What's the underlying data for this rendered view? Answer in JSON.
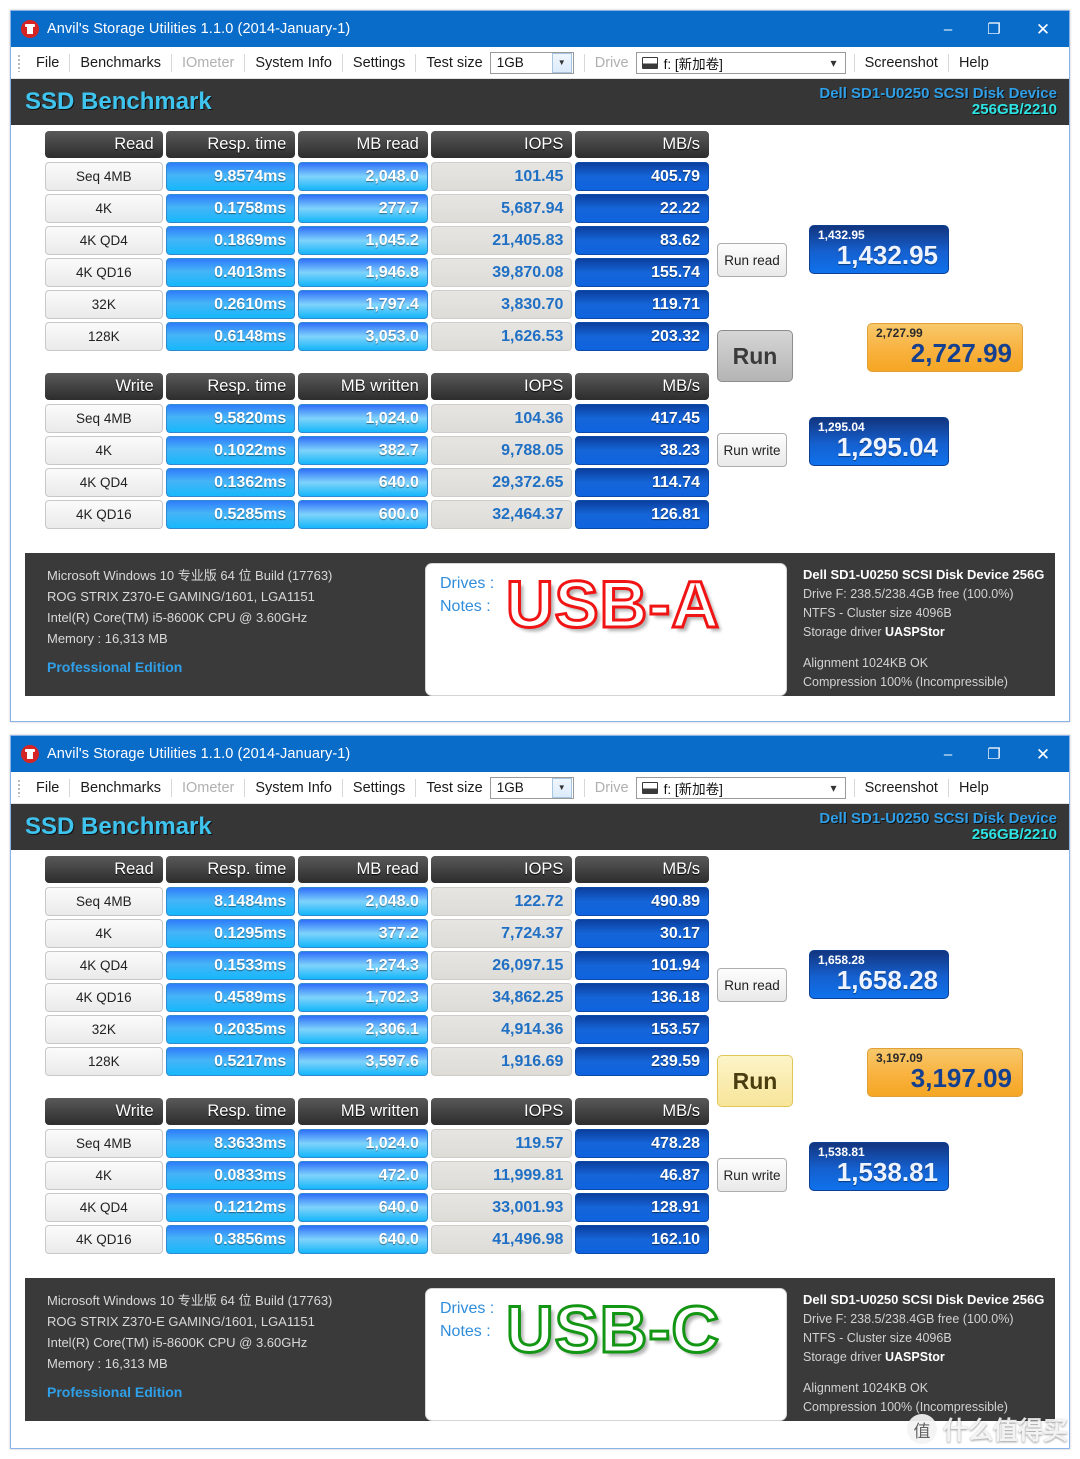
{
  "window": {
    "title": "Anvil's Storage Utilities 1.1.0 (2014-January-1)",
    "icon": "anvil-icon",
    "minimize": "–",
    "maximize": "❐",
    "close": "✕"
  },
  "menu": {
    "items": [
      {
        "label": "File",
        "disabled": false
      },
      {
        "label": "Benchmarks",
        "disabled": false
      },
      {
        "label": "IOmeter",
        "disabled": true
      },
      {
        "label": "System Info",
        "disabled": false
      },
      {
        "label": "Settings",
        "disabled": false
      }
    ],
    "test_size_label": "Test size",
    "test_size_value": "1GB",
    "drive_label": "Drive",
    "drive_value": "f: [新加卷]",
    "screenshot": "Screenshot",
    "help": "Help"
  },
  "band": {
    "title": "SSD Benchmark",
    "device": "Dell SD1-U0250 SCSI Disk Device",
    "capacity": "256GB/2210"
  },
  "buttons": {
    "run_read": "Run read",
    "run": "Run",
    "run_write": "Run write"
  },
  "columns": {
    "read": [
      "Read",
      "Resp. time",
      "MB read",
      "IOPS",
      "MB/s"
    ],
    "write": [
      "Write",
      "Resp. time",
      "MB written",
      "IOPS",
      "MB/s"
    ]
  },
  "system_info": {
    "os": "Microsoft Windows 10 专业版 64 位 Build (17763)",
    "board": "ROG STRIX Z370-E GAMING/1601, LGA1151",
    "cpu": "Intel(R) Core(TM) i5-8600K CPU @ 3.60GHz",
    "memory": "Memory : 16,313 MB",
    "edition": "Professional Edition"
  },
  "drive_info": {
    "device": "Dell SD1-U0250 SCSI Disk Device 256G",
    "free": "Drive F: 238.5/238.4GB free (100.0%)",
    "fs": "NTFS - Cluster size 4096B",
    "driver_label": "Storage driver",
    "driver": "UASPStor",
    "alignment": "Alignment 1024KB OK",
    "compression": "Compression 100% (Incompressible)"
  },
  "note_card": {
    "drives_label": "Drives :",
    "notes_label": "Notes :"
  },
  "watermark": {
    "badge": "值",
    "text": "什么值得买"
  },
  "colors": {
    "titlebar": "#0a6cc9",
    "band_bg": "#363636",
    "band_title": "#3ec4ee",
    "band_device": "#2f9fe8",
    "band_capacity": "#2fe4e4",
    "score_gold": "#f5a623",
    "score_blue": "#1560cf",
    "usb_a_stroke": "#f01414",
    "usb_c_stroke": "#139613"
  },
  "benchmarks": [
    {
      "id": "usb-a",
      "note_word": "USB-A",
      "note_color": "red",
      "run_button_state": "grey",
      "read_rows": [
        {
          "label": "Seq 4MB",
          "resp": "9.8574ms",
          "mb": "2,048.0",
          "iops": "101.45",
          "mbs": "405.79"
        },
        {
          "label": "4K",
          "resp": "0.1758ms",
          "mb": "277.7",
          "iops": "5,687.94",
          "mbs": "22.22"
        },
        {
          "label": "4K QD4",
          "resp": "0.1869ms",
          "mb": "1,045.2",
          "iops": "21,405.83",
          "mbs": "83.62"
        },
        {
          "label": "4K QD16",
          "resp": "0.4013ms",
          "mb": "1,946.8",
          "iops": "39,870.08",
          "mbs": "155.74"
        },
        {
          "label": "32K",
          "resp": "0.2610ms",
          "mb": "1,797.4",
          "iops": "3,830.70",
          "mbs": "119.71"
        },
        {
          "label": "128K",
          "resp": "0.6148ms",
          "mb": "3,053.0",
          "iops": "1,626.53",
          "mbs": "203.32"
        }
      ],
      "write_rows": [
        {
          "label": "Seq 4MB",
          "resp": "9.5820ms",
          "mb": "1,024.0",
          "iops": "104.36",
          "mbs": "417.45"
        },
        {
          "label": "4K",
          "resp": "0.1022ms",
          "mb": "382.7",
          "iops": "9,788.05",
          "mbs": "38.23"
        },
        {
          "label": "4K QD4",
          "resp": "0.1362ms",
          "mb": "640.0",
          "iops": "29,372.65",
          "mbs": "114.74"
        },
        {
          "label": "4K QD16",
          "resp": "0.5285ms",
          "mb": "600.0",
          "iops": "32,464.37",
          "mbs": "126.81"
        }
      ],
      "read_score": "1,432.95",
      "total_score": "2,727.99",
      "write_score": "1,295.04"
    },
    {
      "id": "usb-c",
      "note_word": "USB-C",
      "note_color": "green",
      "run_button_state": "gold",
      "read_rows": [
        {
          "label": "Seq 4MB",
          "resp": "8.1484ms",
          "mb": "2,048.0",
          "iops": "122.72",
          "mbs": "490.89"
        },
        {
          "label": "4K",
          "resp": "0.1295ms",
          "mb": "377.2",
          "iops": "7,724.37",
          "mbs": "30.17"
        },
        {
          "label": "4K QD4",
          "resp": "0.1533ms",
          "mb": "1,274.3",
          "iops": "26,097.15",
          "mbs": "101.94"
        },
        {
          "label": "4K QD16",
          "resp": "0.4589ms",
          "mb": "1,702.3",
          "iops": "34,862.25",
          "mbs": "136.18"
        },
        {
          "label": "32K",
          "resp": "0.2035ms",
          "mb": "2,306.1",
          "iops": "4,914.36",
          "mbs": "153.57"
        },
        {
          "label": "128K",
          "resp": "0.5217ms",
          "mb": "3,597.6",
          "iops": "1,916.69",
          "mbs": "239.59"
        }
      ],
      "write_rows": [
        {
          "label": "Seq 4MB",
          "resp": "8.3633ms",
          "mb": "1,024.0",
          "iops": "119.57",
          "mbs": "478.28"
        },
        {
          "label": "4K",
          "resp": "0.0833ms",
          "mb": "472.0",
          "iops": "11,999.81",
          "mbs": "46.87"
        },
        {
          "label": "4K QD4",
          "resp": "0.1212ms",
          "mb": "640.0",
          "iops": "33,001.93",
          "mbs": "128.91"
        },
        {
          "label": "4K QD16",
          "resp": "0.3856ms",
          "mb": "640.0",
          "iops": "41,496.98",
          "mbs": "162.10"
        }
      ],
      "read_score": "1,658.28",
      "total_score": "3,197.09",
      "write_score": "1,538.81"
    }
  ],
  "chart_data": {
    "type": "table",
    "title": "Anvil's Storage Utilities — SSD Benchmark comparison (USB-A vs USB-C)",
    "device": "Dell SD1-U0250 SCSI Disk Device 256GB/2210",
    "test_size": "1GB",
    "metrics": [
      "Resp. time (ms)",
      "MB read/written",
      "IOPS",
      "MB/s"
    ],
    "categories": [
      "Seq 4MB",
      "4K",
      "4K QD4",
      "4K QD16",
      "32K",
      "128K"
    ],
    "series": [
      {
        "name": "USB-A read MB/s",
        "categories": [
          "Seq 4MB",
          "4K",
          "4K QD4",
          "4K QD16",
          "32K",
          "128K"
        ],
        "values": [
          405.79,
          22.22,
          83.62,
          155.74,
          119.71,
          203.32
        ]
      },
      {
        "name": "USB-C read MB/s",
        "categories": [
          "Seq 4MB",
          "4K",
          "4K QD4",
          "4K QD16",
          "32K",
          "128K"
        ],
        "values": [
          490.89,
          30.17,
          101.94,
          136.18,
          153.57,
          239.59
        ]
      },
      {
        "name": "USB-A write MB/s",
        "categories": [
          "Seq 4MB",
          "4K",
          "4K QD4",
          "4K QD16"
        ],
        "values": [
          417.45,
          38.23,
          114.74,
          126.81
        ]
      },
      {
        "name": "USB-C write MB/s",
        "categories": [
          "Seq 4MB",
          "4K",
          "4K QD4",
          "4K QD16"
        ],
        "values": [
          478.28,
          46.87,
          128.91,
          162.1
        ]
      },
      {
        "name": "USB-A read IOPS",
        "categories": [
          "Seq 4MB",
          "4K",
          "4K QD4",
          "4K QD16",
          "32K",
          "128K"
        ],
        "values": [
          101.45,
          5687.94,
          21405.83,
          39870.08,
          3830.7,
          1626.53
        ]
      },
      {
        "name": "USB-C read IOPS",
        "categories": [
          "Seq 4MB",
          "4K",
          "4K QD4",
          "4K QD16",
          "32K",
          "128K"
        ],
        "values": [
          122.72,
          7724.37,
          26097.15,
          34862.25,
          4914.36,
          1916.69
        ]
      },
      {
        "name": "USB-A write IOPS",
        "categories": [
          "Seq 4MB",
          "4K",
          "4K QD4",
          "4K QD16"
        ],
        "values": [
          104.36,
          9788.05,
          29372.65,
          32464.37
        ]
      },
      {
        "name": "USB-C write IOPS",
        "categories": [
          "Seq 4MB",
          "4K",
          "4K QD4",
          "4K QD16"
        ],
        "values": [
          119.57,
          11999.81,
          33001.93,
          41496.98
        ]
      }
    ],
    "scores": {
      "USB-A": {
        "read": 1432.95,
        "write": 1295.04,
        "total": 2727.99
      },
      "USB-C": {
        "read": 1658.28,
        "write": 1538.81,
        "total": 3197.09
      }
    }
  }
}
